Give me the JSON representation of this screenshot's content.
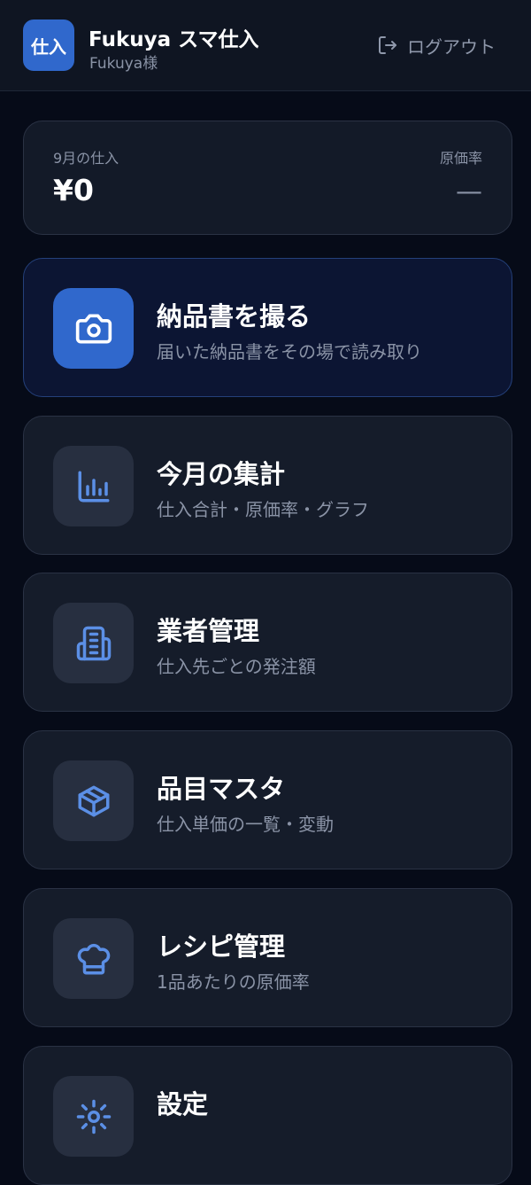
{
  "header": {
    "logo_text": "仕入",
    "app_title": "Fukuya スマ仕入",
    "user_name": "Fukuya様",
    "logout_label": "ログアウト"
  },
  "summary": {
    "purchase_label": "9月の仕入",
    "purchase_value": "¥0",
    "cost_ratio_label": "原価率",
    "cost_ratio_value": "—"
  },
  "menu": [
    {
      "title": "納品書を撮る",
      "subtitle": "届いた納品書をその場で読み取り",
      "icon": "camera-icon"
    },
    {
      "title": "今月の集計",
      "subtitle": "仕入合計・原価率・グラフ",
      "icon": "bar-chart-icon"
    },
    {
      "title": "業者管理",
      "subtitle": "仕入先ごとの発注額",
      "icon": "building-icon"
    },
    {
      "title": "品目マスタ",
      "subtitle": "仕入単価の一覧・変動",
      "icon": "package-icon"
    },
    {
      "title": "レシピ管理",
      "subtitle": "1品あたりの原価率",
      "icon": "chef-hat-icon"
    },
    {
      "title": "設定",
      "subtitle": "",
      "icon": "settings-icon"
    }
  ],
  "colors": {
    "background": "#060b18",
    "accent": "#3068cc",
    "icon_stroke": "#5b8fe6",
    "muted_text": "#8a93a6"
  }
}
